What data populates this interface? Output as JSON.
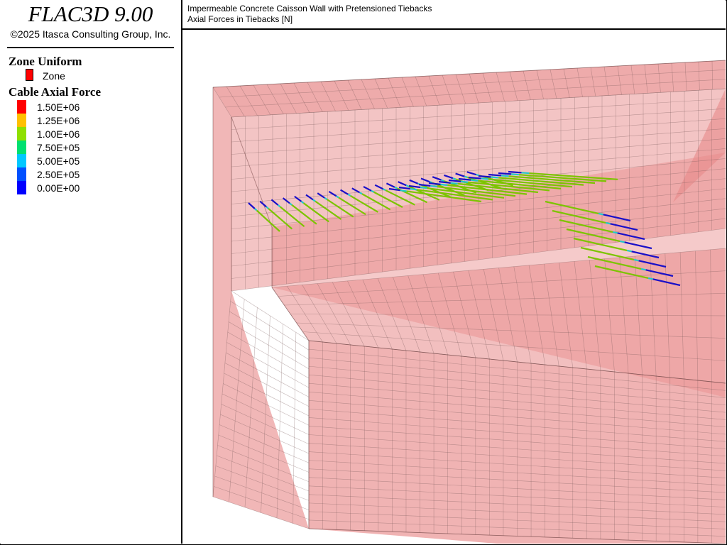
{
  "app": {
    "title": "FLAC3D 9.00",
    "copyright": "©2025 Itasca Consulting Group, Inc."
  },
  "plot": {
    "title": "Impermeable Concrete Caisson Wall with Pretensioned Tiebacks",
    "subtitle": "Axial Forces in Tiebacks [N]"
  },
  "legend": {
    "zone_section": {
      "title": "Zone Uniform",
      "item_label": "Zone",
      "item_color": "#ff0000"
    },
    "cable_section": {
      "title": "Cable Axial Force",
      "items": [
        {
          "label": "1.50E+06",
          "color": "#ff0000"
        },
        {
          "label": "1.25E+06",
          "color": "#ffc000"
        },
        {
          "label": "1.00E+06",
          "color": "#8fe000"
        },
        {
          "label": "7.50E+05",
          "color": "#00e070"
        },
        {
          "label": "5.00E+05",
          "color": "#00c8ff"
        },
        {
          "label": "2.50E+05",
          "color": "#0050ff"
        },
        {
          "label": "0.00E+00",
          "color": "#0000ff"
        }
      ]
    }
  },
  "model": {
    "zone_color": "#e88a8a",
    "mesh_color": "#7a5a5a",
    "cable_green": "#7cc400",
    "cable_blue": "#1a10c8",
    "cable_cyan": "#20c8c8"
  }
}
